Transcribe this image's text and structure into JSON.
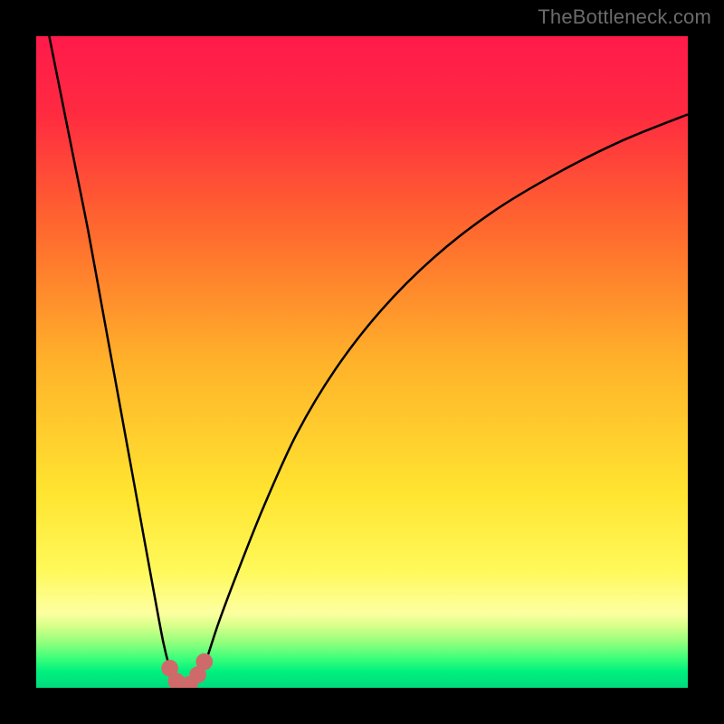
{
  "watermark": "TheBottleneck.com",
  "colors": {
    "frame": "#000000",
    "curve": "#000000",
    "marker_fill": "#cf6a6a",
    "marker_stroke": "#cf6a6a",
    "gradient_stops": [
      {
        "offset": 0.0,
        "color": "#ff1a4b"
      },
      {
        "offset": 0.12,
        "color": "#ff2b40"
      },
      {
        "offset": 0.3,
        "color": "#ff6a2e"
      },
      {
        "offset": 0.5,
        "color": "#ffb22a"
      },
      {
        "offset": 0.7,
        "color": "#ffe430"
      },
      {
        "offset": 0.82,
        "color": "#fff95a"
      },
      {
        "offset": 0.885,
        "color": "#fdffa0"
      },
      {
        "offset": 0.905,
        "color": "#d8ff8a"
      },
      {
        "offset": 0.93,
        "color": "#93ff7d"
      },
      {
        "offset": 0.955,
        "color": "#3cff7a"
      },
      {
        "offset": 0.975,
        "color": "#00f07e"
      },
      {
        "offset": 1.0,
        "color": "#00db7e"
      }
    ]
  },
  "chart_data": {
    "type": "line",
    "title": "",
    "xlabel": "",
    "ylabel": "",
    "xlim": [
      0,
      100
    ],
    "ylim": [
      0,
      100
    ],
    "grid": false,
    "legend": false,
    "series": [
      {
        "name": "bottleneck-curve-left",
        "x": [
          2,
          4,
          6,
          8,
          10,
          12,
          14,
          16,
          18,
          19.5,
          20.5,
          21.3
        ],
        "y": [
          100,
          90,
          80,
          70,
          59,
          48,
          37,
          26,
          15,
          7,
          3,
          0.7
        ]
      },
      {
        "name": "bottleneck-curve-right",
        "x": [
          24.5,
          26,
          28,
          31,
          35,
          40,
          46,
          53,
          61,
          70,
          80,
          90,
          100
        ],
        "y": [
          0.7,
          4,
          10,
          18,
          28,
          39,
          49,
          58,
          66,
          73,
          79,
          84,
          88
        ]
      }
    ],
    "markers": {
      "name": "optimal-region-markers",
      "points": [
        {
          "x": 20.5,
          "y": 3.0
        },
        {
          "x": 21.5,
          "y": 1.0
        },
        {
          "x": 22.5,
          "y": 0.3
        },
        {
          "x": 23.5,
          "y": 0.5
        },
        {
          "x": 24.8,
          "y": 2.0
        },
        {
          "x": 25.8,
          "y": 4.0
        }
      ],
      "radius_pct": 1.3
    }
  }
}
